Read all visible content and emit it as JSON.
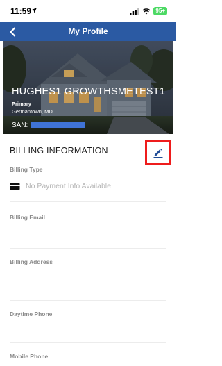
{
  "status_bar": {
    "time": "11:59",
    "battery": "95+",
    "icons": [
      "location-arrow-icon",
      "signal-bars-icon",
      "wifi-icon",
      "battery-icon"
    ]
  },
  "nav": {
    "title": "My Profile",
    "back_icon": "chevron-left-icon",
    "background": "#2b5aa3"
  },
  "profile": {
    "name": "HUGHES1 GROWTHSMETEST1",
    "type": "Primary",
    "location": "Germantown, MD",
    "san_label": "SAN:"
  },
  "billing": {
    "section_title": "BILLING INFORMATION",
    "edit_icon": "pencil-icon",
    "highlight_color": "#ee1c1c",
    "fields": {
      "billing_type": "Billing Type",
      "payment_info": "No Payment Info Available",
      "billing_email": "Billing Email",
      "billing_address": "Billing Address",
      "daytime_phone": "Daytime Phone",
      "mobile_phone": "Mobile Phone"
    }
  }
}
